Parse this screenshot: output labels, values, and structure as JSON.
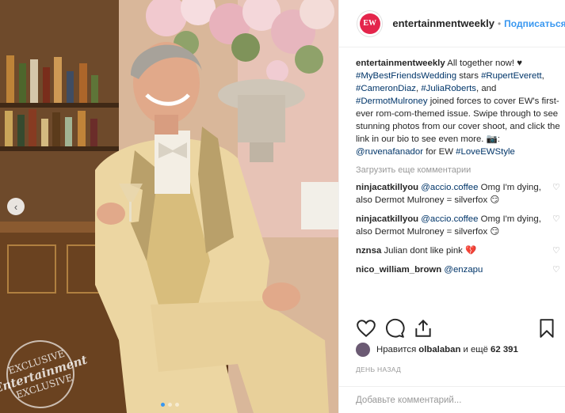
{
  "post": {
    "image_alt": "",
    "stamp_line1": "EXCLUSIVE",
    "stamp_line2": "Entertainment",
    "stamp_line3": "EXCLUSIVE",
    "carousel_count": 3,
    "carousel_active": 1
  },
  "header": {
    "username": "entertainmentweekly",
    "separator": "•",
    "follow_label": "Подписаться",
    "avatar_text": "EW"
  },
  "caption": {
    "username": "entertainmentweekly",
    "t1": " All together now! ",
    "heart": "♥",
    "tag1": "#MyBestFriendsWedding",
    "t2": " stars ",
    "tag2": "#RupertEverett",
    "t3": ", ",
    "tag3": "#CameronDiaz",
    "t4": ", ",
    "tag4": "#JuliaRoberts",
    "t5": ", and ",
    "tag5": "#DermotMulroney",
    "t6": " joined forces to cover EW's first-ever rom-com-themed issue. Swipe through to see stunning photos from our cover shoot, and click the link in our bio to see even more. ",
    "camera": "📷",
    "t7": ": ",
    "tag6": "@ruvenafanador",
    "t8": " for EW ",
    "tag7": "#LoveEWStyle"
  },
  "load_more": "Загрузить еще комментарии",
  "comments": [
    {
      "user": "ninjacatkillyou",
      "mention": "@accio.coffee",
      "text": " Omg I'm dying, also Dermot Mulroney = silverfox 😏"
    },
    {
      "user": "ninjacatkillyou",
      "mention": "@accio.coffee",
      "text": " Omg I'm dying, also Dermot Mulroney = silverfox 😏"
    },
    {
      "user": "nznsa",
      "mention": "",
      "text": " Julian dont like pink 💔"
    },
    {
      "user": "nico_william_brown",
      "mention": "@enzapu",
      "text": ""
    }
  ],
  "likes": {
    "prefix": "Нравится",
    "user": "olbalaban",
    "middle": "и ещё",
    "count": "62 391"
  },
  "date": "ДЕНЬ НАЗАД",
  "add_comment_placeholder": "Добавьте комментарий...",
  "colors": {
    "link": "#003569",
    "follow": "#3897f0",
    "muted": "#999999"
  }
}
